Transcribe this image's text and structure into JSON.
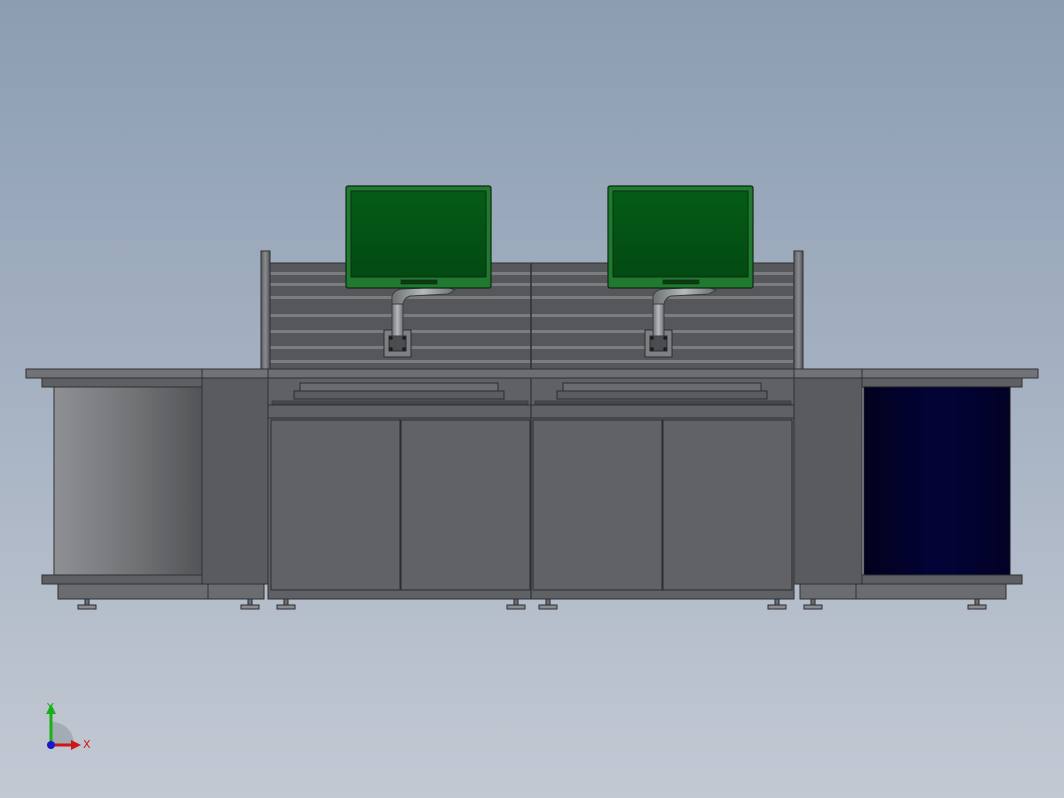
{
  "viewport": {
    "background_top": "#8c9db2",
    "background_bottom": "#c3c9d3"
  },
  "model": {
    "console_body_color": "#5f6164",
    "console_edge_color": "#3e4043",
    "end_unit_left_fill": "gray-gradient",
    "end_unit_right_fill": "#020230",
    "monitor_screen_color": "#045a16",
    "monitor_bezel_color": "#1f7a30",
    "monitor_count": 2,
    "door_count": 4,
    "leveling_foot_count": 10
  },
  "triad": {
    "x_label": "X",
    "y_label": "Y",
    "x_color": "#cc1818",
    "y_color": "#18b018",
    "z_color": "#1818cc"
  }
}
